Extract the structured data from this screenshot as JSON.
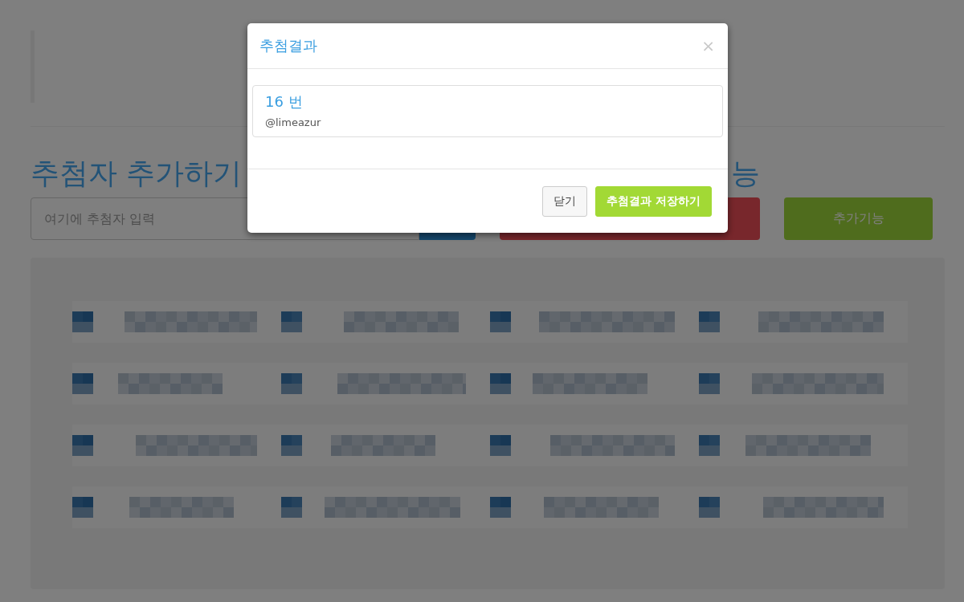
{
  "page": {
    "heading": "추첨자 추가하기",
    "heading_2": "능",
    "input": {
      "placeholder": "여기에 추첨자 입력"
    },
    "extra_button": "추가기능"
  },
  "modal": {
    "title": "추첨결과",
    "close": "×",
    "result": {
      "number": "16 번",
      "handle": "@limeazur"
    },
    "buttons": [
      {
        "label": "닫기",
        "kind": "default"
      },
      {
        "label": "추첨결과 저장하기",
        "kind": "success"
      }
    ]
  }
}
